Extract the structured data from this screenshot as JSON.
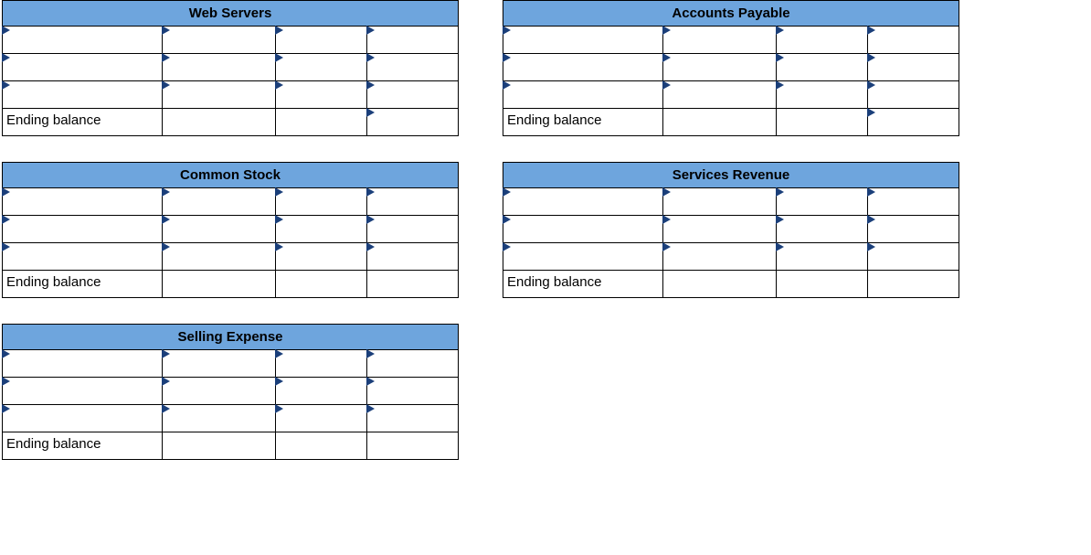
{
  "tables": [
    {
      "title": "Web Servers",
      "ending_label": "Ending balance"
    },
    {
      "title": "Accounts Payable",
      "ending_label": "Ending balance"
    },
    {
      "title": "Common Stock",
      "ending_label": "Ending balance"
    },
    {
      "title": "Services Revenue",
      "ending_label": "Ending balance"
    },
    {
      "title": "Selling Expense",
      "ending_label": "Ending balance"
    }
  ]
}
